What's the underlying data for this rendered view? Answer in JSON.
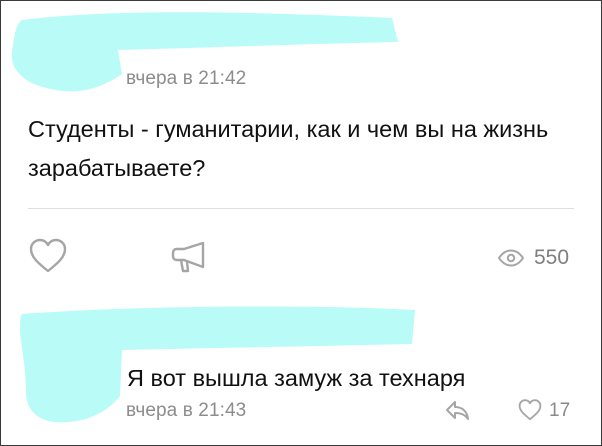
{
  "post": {
    "timestamp": "вчера в 21:42",
    "text": "Студенты - гуманитарии, как и чем вы на жизнь зарабатываете?",
    "views_count": "550",
    "like_icon": "heart-icon",
    "share_icon": "megaphone-icon",
    "views_icon": "eye-icon"
  },
  "comment": {
    "text": "Я вот вышла замуж за технаря",
    "timestamp": "вчера в 21:43",
    "reply_icon": "reply-arrow-icon",
    "like_icon": "heart-icon",
    "likes_count": "17"
  },
  "colors": {
    "redaction": "#b9fbf6",
    "muted_text": "#8c8c8c",
    "icon_gray": "#a5a5a5"
  }
}
